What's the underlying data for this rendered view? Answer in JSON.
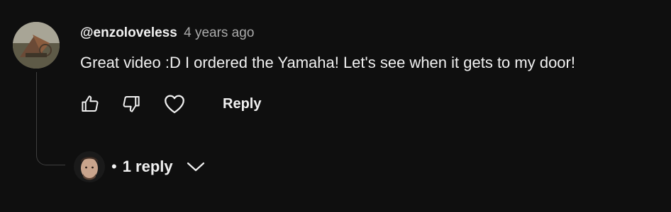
{
  "comment": {
    "author": "@enzoloveless",
    "timestamp": "4 years ago",
    "text": "Great video :D I ordered the Yamaha! Let's see when it gets to my door!",
    "actions": {
      "like_icon": "thumbs-up-icon",
      "dislike_icon": "thumbs-down-icon",
      "heart_icon": "heart-icon",
      "reply_label": "Reply"
    }
  },
  "replies": {
    "label": "1 reply",
    "bullet": "•",
    "expand_icon": "chevron-down-icon"
  },
  "colors": {
    "background": "#0f0f0f",
    "primary_text": "#f1f1f1",
    "secondary_text": "#aaaaaa",
    "thread_line": "#3f3f3f"
  }
}
